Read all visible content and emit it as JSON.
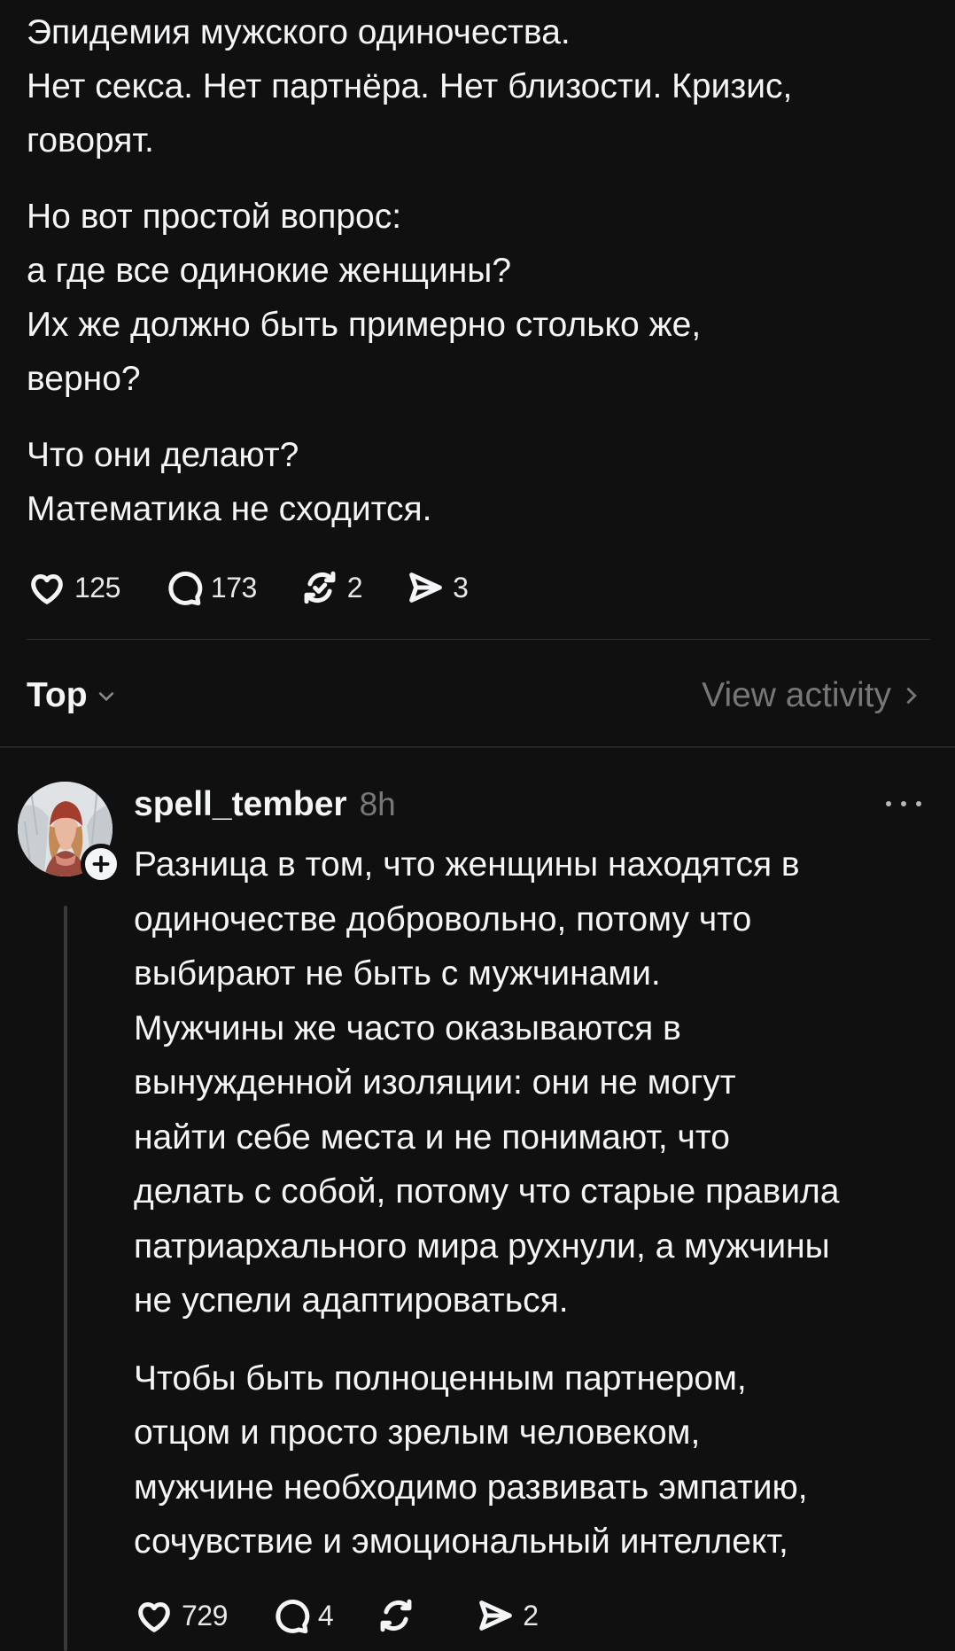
{
  "post": {
    "paragraphs": [
      [
        "Эпидемия мужского одиночества.",
        "Нет секса. Нет партнёра. Нет близости. Кризис,",
        "говорят."
      ],
      [
        "Но вот простой вопрос:",
        "а где все одинокие женщины?",
        "Их же должно быть примерно столько же,",
        "верно?"
      ],
      [
        "Что они делают?",
        "Математика не сходится."
      ]
    ],
    "likes": "125",
    "comments": "173",
    "reposts": "2",
    "shares": "3"
  },
  "sort": {
    "label": "Top",
    "view_activity": "View activity"
  },
  "reply": {
    "username": "spell_tember",
    "time": "8h",
    "paragraphs": [
      [
        "Разница в том, что женщины находятся в",
        "одиночестве добровольно, потому что",
        "выбирают не быть с мужчинами.",
        "Мужчины же часто оказываются в",
        "вынужденной изоляции: они не могут",
        "найти себе места и не понимают, что",
        "делать с собой, потому что старые правила",
        "патриархального мира рухнули, а мужчины",
        "не успели адаптироваться."
      ],
      [
        "Чтобы быть полноценным партнером,",
        "отцом и просто зрелым человеком,",
        "мужчине необходимо развивать эмпатию,",
        "сочувствие и эмоциональный интеллект,"
      ]
    ],
    "likes": "729",
    "comments": "4",
    "reposts": "",
    "shares": "2"
  },
  "icons": {
    "like": "heart-icon",
    "comment": "speech-bubble-icon",
    "repost": "repost-icon",
    "share": "paper-plane-icon",
    "follow": "plus-icon",
    "more": "ellipsis-icon"
  },
  "colors": {
    "background": "#101010",
    "text": "#f3f5f7",
    "muted": "#777777"
  }
}
